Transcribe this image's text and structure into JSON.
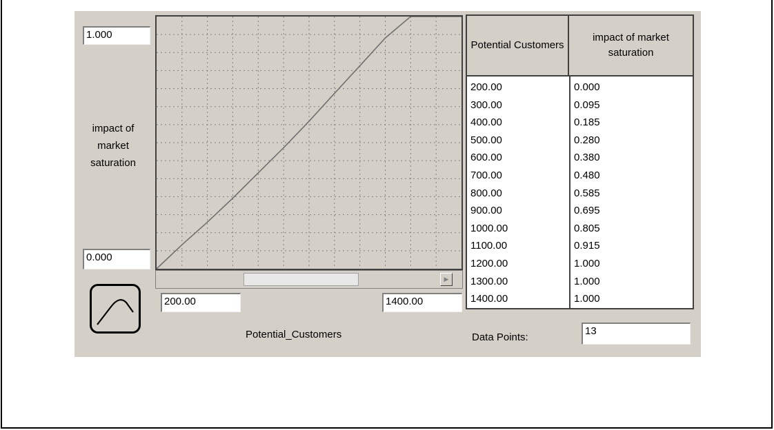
{
  "graph": {
    "y_axis_label": "impact of market saturation",
    "y_max": "1.000",
    "y_min": "0.000",
    "x_min": "200.00",
    "x_max": "1400.00",
    "x_axis_label": "Potential_Customers",
    "colors": {
      "line": "#707070",
      "grid": "#808080",
      "background": "#d4d0c8"
    }
  },
  "table": {
    "headers": [
      "Potential Customers",
      "impact of market saturation"
    ],
    "rows": [
      [
        "200.00",
        "0.000"
      ],
      [
        "300.00",
        "0.095"
      ],
      [
        "400.00",
        "0.185"
      ],
      [
        "500.00",
        "0.280"
      ],
      [
        "600.00",
        "0.380"
      ],
      [
        "700.00",
        "0.480"
      ],
      [
        "800.00",
        "0.585"
      ],
      [
        "900.00",
        "0.695"
      ],
      [
        "1000.00",
        "0.805"
      ],
      [
        "1100.00",
        "0.915"
      ],
      [
        "1200.00",
        "1.000"
      ],
      [
        "1300.00",
        "1.000"
      ],
      [
        "1400.00",
        "1.000"
      ]
    ]
  },
  "data_points": {
    "label": "Data Points:",
    "value": "13"
  },
  "icons": {
    "graph_type": "curve-graph-icon",
    "scroll_left": "arrow-left-icon",
    "scroll_right": "arrow-right-icon"
  }
}
